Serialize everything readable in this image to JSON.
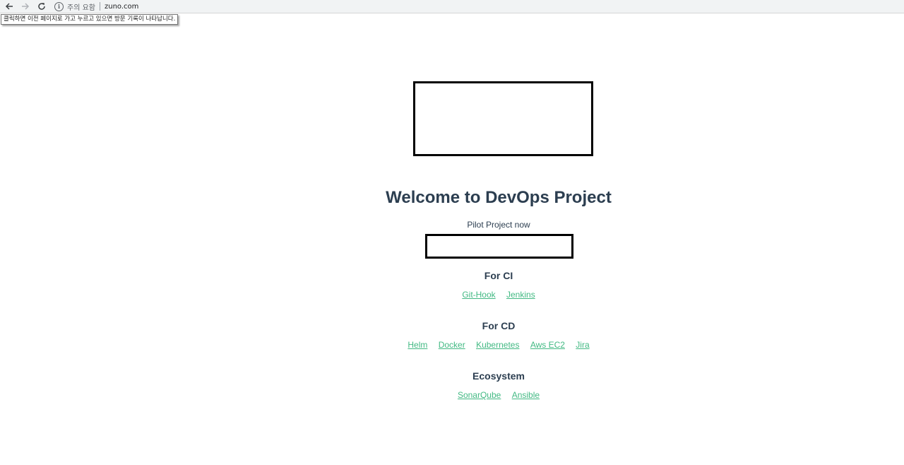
{
  "browser": {
    "security_label": "주의 요함",
    "info_glyph": "i",
    "url": "zuno.com",
    "back_tooltip": "클릭하면 이전 페이지로 가고 누르고 있으면 방문 기록이 나타납니다."
  },
  "page": {
    "title": "Welcome to DevOps Project",
    "subtitle": "Pilot Project now",
    "sections": [
      {
        "title": "For CI",
        "links": [
          "Git-Hook",
          "Jenkins"
        ]
      },
      {
        "title": "For CD",
        "links": [
          "Helm",
          "Docker",
          "Kubernetes",
          "Aws EC2",
          "Jira"
        ]
      },
      {
        "title": "Ecosystem",
        "links": [
          "SonarQube",
          "Ansible"
        ]
      }
    ]
  },
  "colors": {
    "heading": "#2c3e50",
    "link": "#42b983",
    "toolbar_bg": "#f1f3f4"
  },
  "icons": {
    "back": "arrow-left-icon",
    "forward": "arrow-right-icon",
    "reload": "reload-icon",
    "info": "info-icon"
  }
}
